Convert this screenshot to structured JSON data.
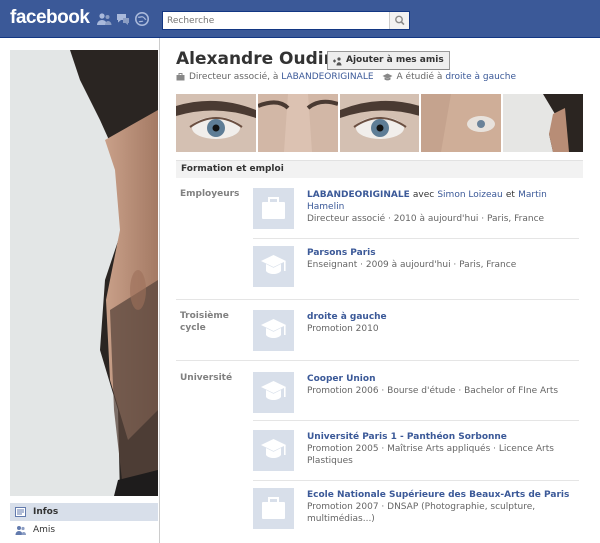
{
  "header": {
    "logo": "facebook",
    "search_placeholder": "Recherche",
    "jewels": [
      "friend-requests-icon",
      "messages-icon",
      "notifications-icon"
    ],
    "colors": {
      "bar": "#3b5998",
      "link": "#3b5998"
    }
  },
  "left": {
    "nav": [
      {
        "label": "Infos",
        "active": true
      },
      {
        "label": "Amis",
        "active": false
      }
    ]
  },
  "profile": {
    "name": "Alexandre Oudin",
    "add_friend_label": "Ajouter à mes amis",
    "work_prefix": "Directeur associé, à",
    "work_link": "LABANDEORIGINALE",
    "study_prefix": "A étudié à",
    "study_link": "droite à gauche"
  },
  "section": {
    "title": "Formation et emploi",
    "groups": [
      {
        "label": "Employeurs",
        "entries": [
          {
            "title": "LABANDEORIGINALE",
            "with_word": "avec",
            "person1": "Simon Loizeau",
            "and_word": "et",
            "person2": "Martin Hamelin",
            "detail": "Directeur associé · 2010 à aujourd'hui · Paris, France",
            "thumb": "briefcase-icon"
          },
          {
            "title": "Parsons Paris",
            "detail": "Enseignant · 2009 à aujourd'hui · Paris, France",
            "thumb": "graduation-cap-icon"
          }
        ]
      },
      {
        "label": "Troisième cycle",
        "entries": [
          {
            "title": "droite à gauche",
            "detail": "Promotion 2010",
            "thumb": "graduation-cap-icon"
          }
        ]
      },
      {
        "label": "Université",
        "entries": [
          {
            "title": "Cooper Union",
            "detail": "Promotion 2006 · Bourse d'étude · Bachelor of FIne Arts",
            "thumb": "graduation-cap-icon"
          },
          {
            "title": "Université Paris 1 - Panthéon Sorbonne",
            "detail": "Promotion 2005 · Maîtrise Arts appliqués · Licence Arts Plastiques",
            "thumb": "graduation-cap-icon"
          },
          {
            "title": "Ecole Nationale Supérieure des Beaux-Arts de Paris",
            "detail": "Promotion 2007 · DNSAP (Photographie, sculpture, multimédias...)",
            "thumb": "briefcase-icon"
          }
        ]
      }
    ]
  }
}
